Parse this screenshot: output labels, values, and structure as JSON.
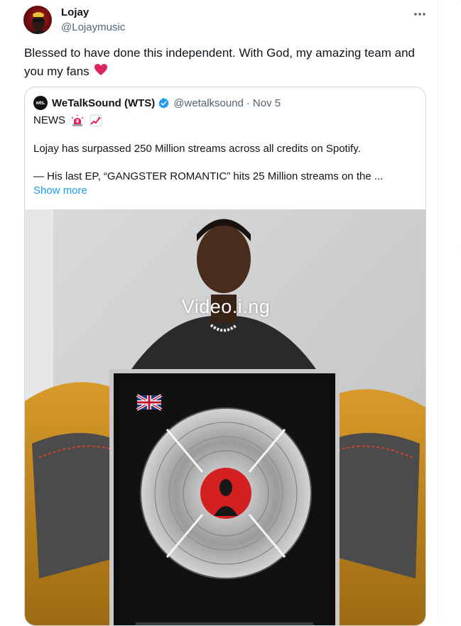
{
  "tweet": {
    "author_name": "Lojay",
    "author_handle": "@Lojaymusic",
    "text": "Blessed to have done this independent. With God, my amazing team and you my fans",
    "heart_emoji": "red-heart"
  },
  "quote": {
    "avatar_text": "wts.",
    "name": "WeTalkSound (WTS)",
    "handle": "@wetalksound",
    "separator": "·",
    "date": "Nov 5",
    "line1": "NEWS",
    "line1_emojis": [
      "police-light",
      "chart-increasing"
    ],
    "line2": "Lojay has surpassed 250 Million streams across all credits on Spotify.",
    "line3": "— His last EP, “GANGSTER ROMANTIC” hits 25 Million streams on the ...",
    "show_more": "Show more",
    "media_watermark": "Video.i.ng",
    "media_icon": "uk-flag"
  },
  "colors": {
    "link": "#1d9bf0",
    "secondary_text": "#536471",
    "verified": "#1d9bf0",
    "heart": "#e0245e",
    "border": "#cfd9de"
  }
}
